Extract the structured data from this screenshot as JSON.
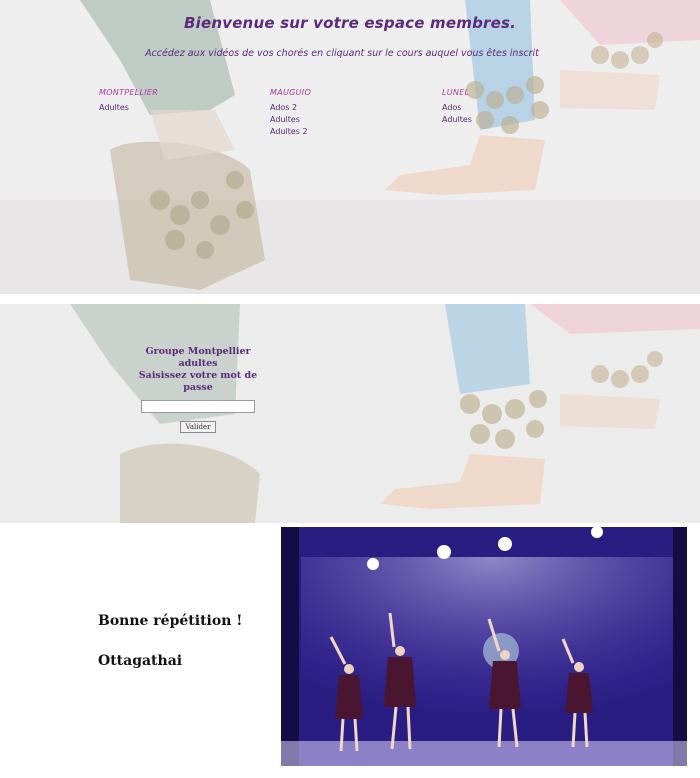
{
  "header": {
    "title": "Bienvenue sur votre espace membres.",
    "subtitle": "Accédez aux vidéos de vos chorés en cliquant sur le cours auquel vous êtes inscrit"
  },
  "courses": [
    {
      "city": "MONTPELLIER",
      "links": [
        "Adultes"
      ]
    },
    {
      "city": "MAUGUIO",
      "links": [
        "Ados 2",
        "Adultes",
        "Adultes 2"
      ]
    },
    {
      "city": "LUNEL",
      "links": [
        "Ados",
        "Adultes"
      ]
    }
  ],
  "login": {
    "group_title": "Groupe Montpellier adultes",
    "prompt": "Saisissez votre mot de passe",
    "password_value": "",
    "submit_label": "Valider"
  },
  "footer": {
    "message": "Bonne répétition !",
    "signature": "Ottagathai"
  },
  "colors": {
    "accent": "#5b2a7a",
    "city": "#b0369c"
  }
}
